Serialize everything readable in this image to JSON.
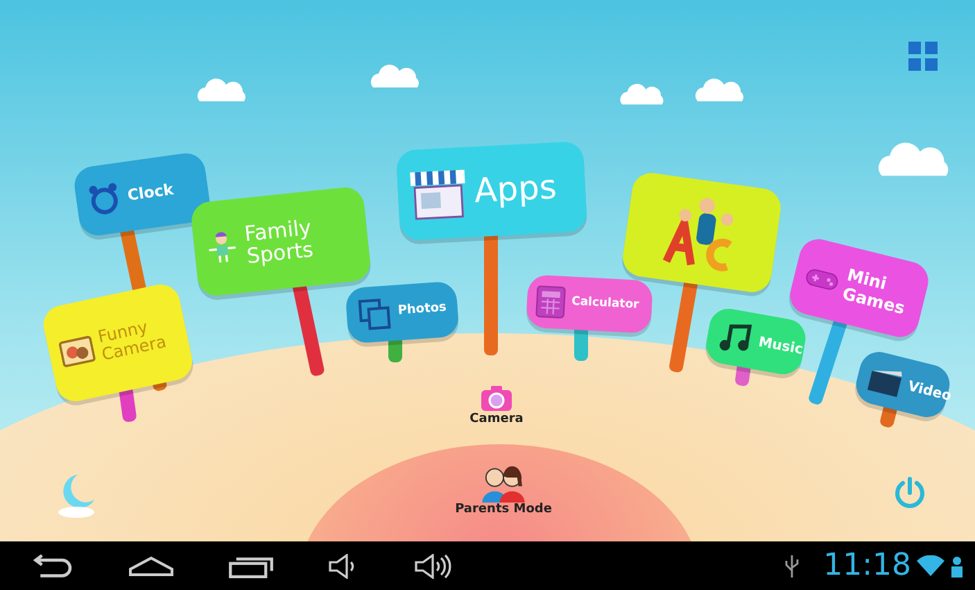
{
  "signs": [
    {
      "kind": "clock",
      "label": "Clock",
      "color": "#2ba6d6"
    },
    {
      "kind": "sports",
      "label": "Family Sports",
      "color": "#6ee03c"
    },
    {
      "kind": "funny-camera",
      "label": "Funny Camera",
      "color": "#f5ee2a"
    },
    {
      "kind": "photos",
      "label": "Photos",
      "color": "#2a9fcf"
    },
    {
      "kind": "apps",
      "label": "Apps",
      "color": "#38d2e6"
    },
    {
      "kind": "calculator",
      "label": "Calculator",
      "color": "#f062d2"
    },
    {
      "kind": "abc",
      "color": "#d6ef22"
    },
    {
      "kind": "music",
      "label": "Music",
      "color": "#2fe07c"
    },
    {
      "kind": "games",
      "label": "Mini Games",
      "color": "#ea52e2"
    },
    {
      "kind": "video",
      "label": "Video",
      "color": "#2f96c6"
    }
  ],
  "camera": {
    "label": "Camera"
  },
  "parents_mode": {
    "label": "Parents Mode"
  },
  "status_bar": {
    "time": "11:18"
  }
}
